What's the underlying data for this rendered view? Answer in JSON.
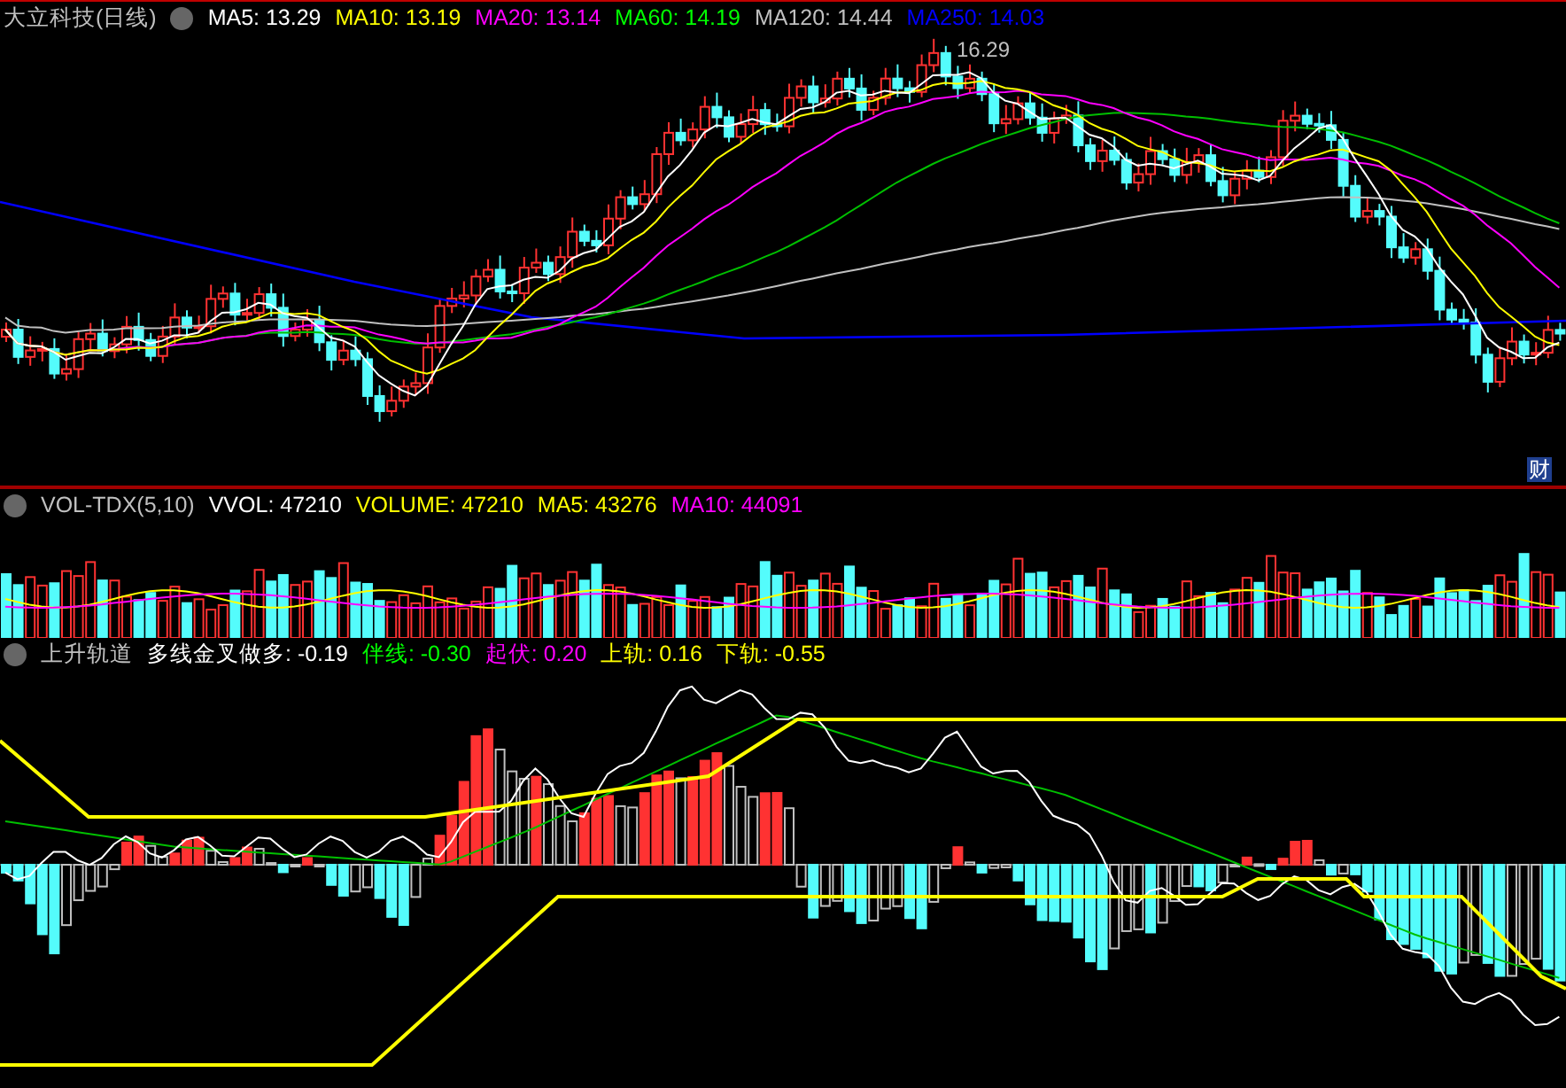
{
  "stock_panel": {
    "title": "大立科技(日线)",
    "indicators": [
      {
        "label": "MA5: 13.29",
        "color": "#ffffff"
      },
      {
        "label": "MA10: 13.19",
        "color": "#ffff00"
      },
      {
        "label": "MA20: 13.14",
        "color": "#ff00ff"
      },
      {
        "label": "MA60: 14.19",
        "color": "#00ff00"
      },
      {
        "label": "MA120: 14.44",
        "color": "#c0c0c0"
      },
      {
        "label": "MA250: 14.03",
        "color": "#0000ff"
      }
    ],
    "high_label": "16.29",
    "badge": "财"
  },
  "volume_panel": {
    "title": "VOL-TDX(5,10)",
    "indicators": [
      {
        "label": "VVOL: 47210",
        "color": "#ffffff"
      },
      {
        "label": "VOLUME: 47210",
        "color": "#ffff00"
      },
      {
        "label": "MA5: 43276",
        "color": "#ffff00"
      },
      {
        "label": "MA10: 44091",
        "color": "#ff00ff"
      }
    ]
  },
  "indicator_panel": {
    "title": "上升轨道",
    "indicators": [
      {
        "label": "多线金叉做多: -0.19",
        "color": "#ffffff"
      },
      {
        "label": "伴线: -0.30",
        "color": "#00ff00"
      },
      {
        "label": "起伏: 0.20",
        "color": "#ff00ff"
      },
      {
        "label": "上轨: 0.16",
        "color": "#ffff00"
      },
      {
        "label": "下轨: -0.55",
        "color": "#ffff00"
      }
    ]
  }
}
